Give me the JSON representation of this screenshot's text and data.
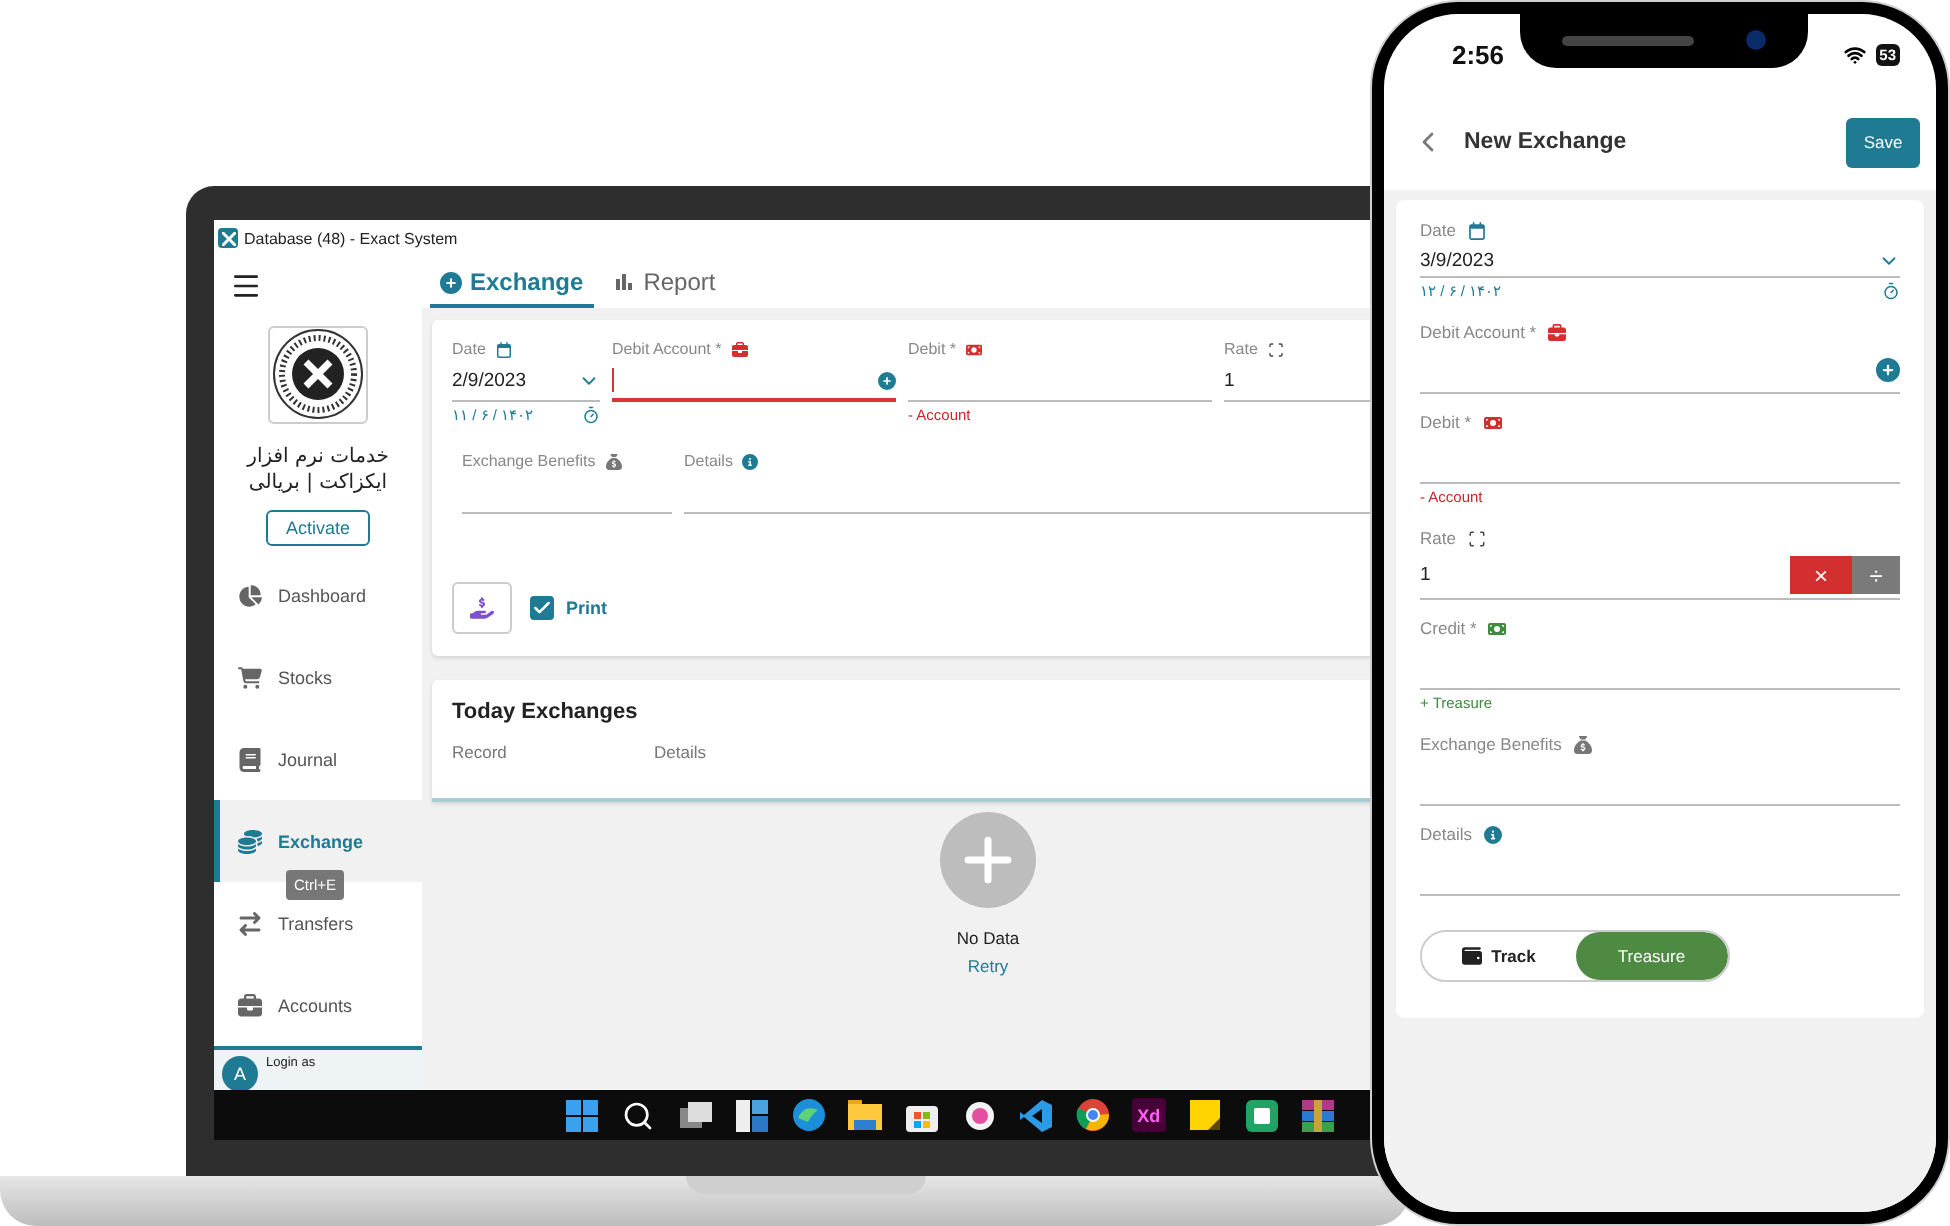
{
  "laptop": {
    "window_title": "Database (48) - Exact System",
    "sidebar": {
      "company_lines": [
        "خدمات نرم افزار",
        "ایکزاکت | بریالی"
      ],
      "activate": "Activate",
      "items": [
        {
          "label": "Dashboard",
          "selected": false
        },
        {
          "label": "Stocks",
          "selected": false
        },
        {
          "label": "Journal",
          "selected": false
        },
        {
          "label": "Exchange",
          "selected": true
        },
        {
          "label": "Transfers",
          "selected": false
        },
        {
          "label": "Accounts",
          "selected": false
        }
      ],
      "tooltip": "Ctrl+E",
      "user_initial": "A",
      "login_label": "Login as"
    },
    "tabs": [
      {
        "label": "Exchange",
        "selected": true
      },
      {
        "label": "Report",
        "selected": false
      }
    ],
    "form": {
      "rows": [
        [
          {
            "kind": "date",
            "label": "Date",
            "value": "2/9/2023",
            "alt_date": "۱۱ / ۶ / ۱۴۰۲",
            "focused": false
          },
          {
            "kind": "account",
            "label": "Debit Account *",
            "focused": true
          },
          {
            "kind": "debit",
            "label": "Debit *",
            "hint": "- Account",
            "focused": false
          },
          {
            "kind": "rate",
            "label": "Rate",
            "value": "1",
            "focused": false
          }
        ],
        [
          {
            "kind": "benefits",
            "label": "Exchange Benefits",
            "focused": false
          },
          {
            "kind": "details",
            "label": "Details",
            "focused": false
          }
        ]
      ],
      "print": {
        "label": "Print",
        "checked": true
      }
    },
    "today": {
      "title": "Today Exchanges",
      "columns": [
        "Record",
        "Details"
      ],
      "empty_text": "No Data",
      "retry": "Retry"
    },
    "taskbar": [
      {
        "kind": "start"
      },
      {
        "kind": "search"
      },
      {
        "kind": "taskview"
      },
      {
        "kind": "widgets"
      },
      {
        "kind": "edge"
      },
      {
        "kind": "folder"
      },
      {
        "kind": "store"
      },
      {
        "kind": "pinkapp"
      },
      {
        "kind": "vscode"
      },
      {
        "kind": "chrome"
      },
      {
        "kind": "xd",
        "label": "Xd"
      },
      {
        "kind": "sticky"
      },
      {
        "kind": "greenapp"
      },
      {
        "kind": "archive"
      }
    ]
  },
  "phone": {
    "time": "2:56",
    "battery": "53",
    "title": "New Exchange",
    "save": "Save",
    "fields": [
      {
        "kind": "date",
        "label": "Date",
        "value": "3/9/2023",
        "alt_date": "۱۲ / ۶ / ۱۴۰۲",
        "focused": false
      },
      {
        "kind": "account",
        "label": "Debit Account *",
        "focused": false
      },
      {
        "kind": "debit",
        "label": "Debit *",
        "hint": "- Account",
        "focused": false
      },
      {
        "kind": "rate",
        "label": "Rate",
        "value": "1",
        "operators": [
          {
            "symbol": "×",
            "selected": true
          },
          {
            "symbol": "÷",
            "selected": false
          }
        ],
        "focused": false
      },
      {
        "kind": "credit",
        "label": "Credit *",
        "hint": "+ Treasure",
        "focused": false
      },
      {
        "kind": "benefits",
        "label": "Exchange Benefits",
        "focused": false
      },
      {
        "kind": "details",
        "label": "Details",
        "focused": false
      }
    ],
    "toggle": [
      {
        "label": "Track",
        "selected": false
      },
      {
        "label": "Treasure",
        "selected": true
      }
    ]
  }
}
